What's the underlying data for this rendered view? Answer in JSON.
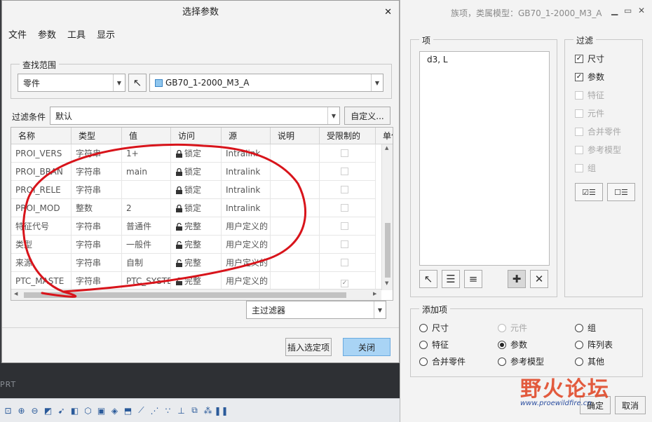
{
  "dialog": {
    "title": "选择参数",
    "menu": [
      "文件",
      "参数",
      "工具",
      "显示"
    ],
    "search_scope_label": "查找范围",
    "scope_value": "零件",
    "model_value": "GB70_1-2000_M3_A",
    "filter_label": "过滤条件",
    "filter_value": "默认",
    "custom_button": "自定义...",
    "columns": [
      "名称",
      "类型",
      "值",
      "访问",
      "源",
      "说明",
      "受限制的",
      "单位"
    ],
    "rows": [
      {
        "name": "PROI_VERS",
        "type": "字符串",
        "value": "1+",
        "access": "锁定",
        "source": "Intralink",
        "restricted": false
      },
      {
        "name": "PROI_BRAN",
        "type": "字符串",
        "value": "main",
        "access": "锁定",
        "source": "Intralink",
        "restricted": false
      },
      {
        "name": "PROI_RELE",
        "type": "字符串",
        "value": "",
        "access": "锁定",
        "source": "Intralink",
        "restricted": false
      },
      {
        "name": "PROI_MOD",
        "type": "整数",
        "value": "2",
        "access": "锁定",
        "source": "Intralink",
        "restricted": false
      },
      {
        "name": "特征代号",
        "type": "字符串",
        "value": "普通件",
        "access": "完整",
        "source": "用户定义的",
        "restricted": false
      },
      {
        "name": "类型",
        "type": "字符串",
        "value": "一般件",
        "access": "完整",
        "source": "用户定义的",
        "restricted": false
      },
      {
        "name": "来源",
        "type": "字符串",
        "value": "自制",
        "access": "完整",
        "source": "用户定义的",
        "restricted": false
      },
      {
        "name": "PTC_MASTE",
        "type": "字符串",
        "value": "PTC_SYSTE",
        "access": "完整",
        "source": "用户定义的",
        "restricted": true
      }
    ],
    "main_filter": "主过滤器",
    "insert_button": "插入选定项",
    "close_button": "关闭"
  },
  "family": {
    "title": "族项，类属模型：GB70_1-2000_M3_A",
    "items_label": "项",
    "items_value": "d3, L",
    "filter_label": "过滤",
    "filters": [
      {
        "label": "尺寸",
        "checked": true,
        "enabled": true
      },
      {
        "label": "参数",
        "checked": true,
        "enabled": true
      },
      {
        "label": "特征",
        "checked": false,
        "enabled": false
      },
      {
        "label": "元件",
        "checked": false,
        "enabled": false
      },
      {
        "label": "合并零件",
        "checked": false,
        "enabled": false
      },
      {
        "label": "参考模型",
        "checked": false,
        "enabled": false
      },
      {
        "label": "组",
        "checked": false,
        "enabled": false
      }
    ],
    "add_label": "添加项",
    "add_options": [
      {
        "label": "尺寸",
        "selected": false,
        "enabled": true
      },
      {
        "label": "元件",
        "selected": false,
        "enabled": false
      },
      {
        "label": "组",
        "selected": false,
        "enabled": true
      },
      {
        "label": "特征",
        "selected": false,
        "enabled": true
      },
      {
        "label": "参数",
        "selected": true,
        "enabled": true
      },
      {
        "label": "阵列表",
        "selected": false,
        "enabled": true
      },
      {
        "label": "合并零件",
        "selected": false,
        "enabled": true
      },
      {
        "label": "参考模型",
        "selected": false,
        "enabled": true
      },
      {
        "label": "其他",
        "selected": false,
        "enabled": true
      }
    ],
    "ok_button": "确定",
    "cancel_button": "取消"
  },
  "background": {
    "label": "PRT"
  },
  "watermark": {
    "text": "野火论坛",
    "url": "www.proewildfire.cn"
  },
  "colors": {
    "annotation": "#d8141b",
    "primary_button": "#a9d4f5"
  }
}
